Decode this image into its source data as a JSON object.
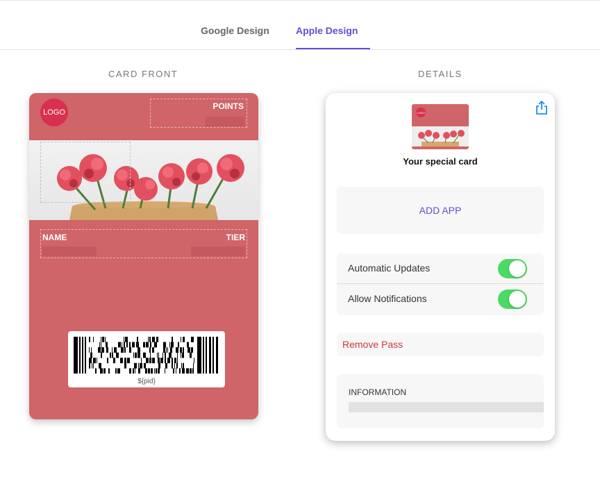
{
  "tabs": [
    {
      "label": "Google Design",
      "active": false
    },
    {
      "label": "Apple Design",
      "active": true
    }
  ],
  "sections": {
    "front_title": "CARD FRONT",
    "details_title": "DETAILS"
  },
  "card": {
    "logo_text": "LOGO",
    "points_label": "POINTS",
    "name_label": "NAME",
    "tier_label": "TIER",
    "barcode_text": "${pid}",
    "background_color": "#cf6469"
  },
  "details": {
    "thumb_logo_text": "LOGO",
    "card_title": "Your special card",
    "add_app_label": "ADD APP",
    "toggles": [
      {
        "label": "Automatic Updates",
        "on": true
      },
      {
        "label": "Allow Notifications",
        "on": true
      }
    ],
    "remove_label": "Remove Pass",
    "information_label": "INFORMATION"
  },
  "colors": {
    "accent": "#5b4fd6",
    "toggle_on": "#4cd964",
    "danger": "#c9383f",
    "logo": "#d8304f"
  }
}
